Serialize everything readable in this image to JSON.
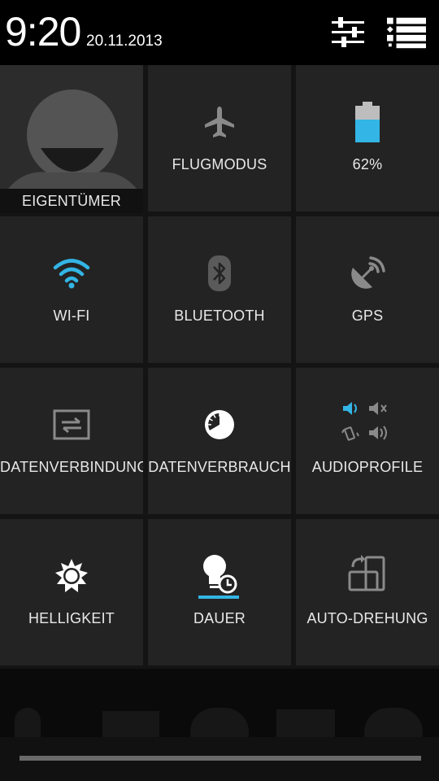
{
  "header": {
    "time": "9:20",
    "date": "20.11.2013",
    "settings_icon": "sliders-icon",
    "notifications_icon": "list-icon"
  },
  "tiles": [
    {
      "label": "EIGENTÜMER",
      "icon": "user-avatar-icon"
    },
    {
      "label": "FLUGMODUS",
      "icon": "airplane-icon"
    },
    {
      "label": "62%",
      "icon": "battery-icon",
      "battery_level": 0.62
    },
    {
      "label": "WI-FI",
      "icon": "wifi-icon"
    },
    {
      "label": "BLUETOOTH",
      "icon": "bluetooth-icon"
    },
    {
      "label": "GPS",
      "icon": "gps-icon"
    },
    {
      "label": "DATENVERBINDUNG",
      "icon": "data-connection-icon"
    },
    {
      "label": "DATENVERBRAUCH",
      "icon": "data-usage-icon"
    },
    {
      "label": "AUDIOPROFILE",
      "icon": "audio-profiles-icon"
    },
    {
      "label": "HELLIGKEIT",
      "icon": "brightness-icon"
    },
    {
      "label": "DAUER",
      "icon": "screen-timeout-icon"
    },
    {
      "label": "AUTO-DREHUNG",
      "icon": "auto-rotate-icon"
    }
  ],
  "colors": {
    "accent": "#33b5e5",
    "icon_gray": "#8a8a8a",
    "tile_bg": "#232323"
  }
}
